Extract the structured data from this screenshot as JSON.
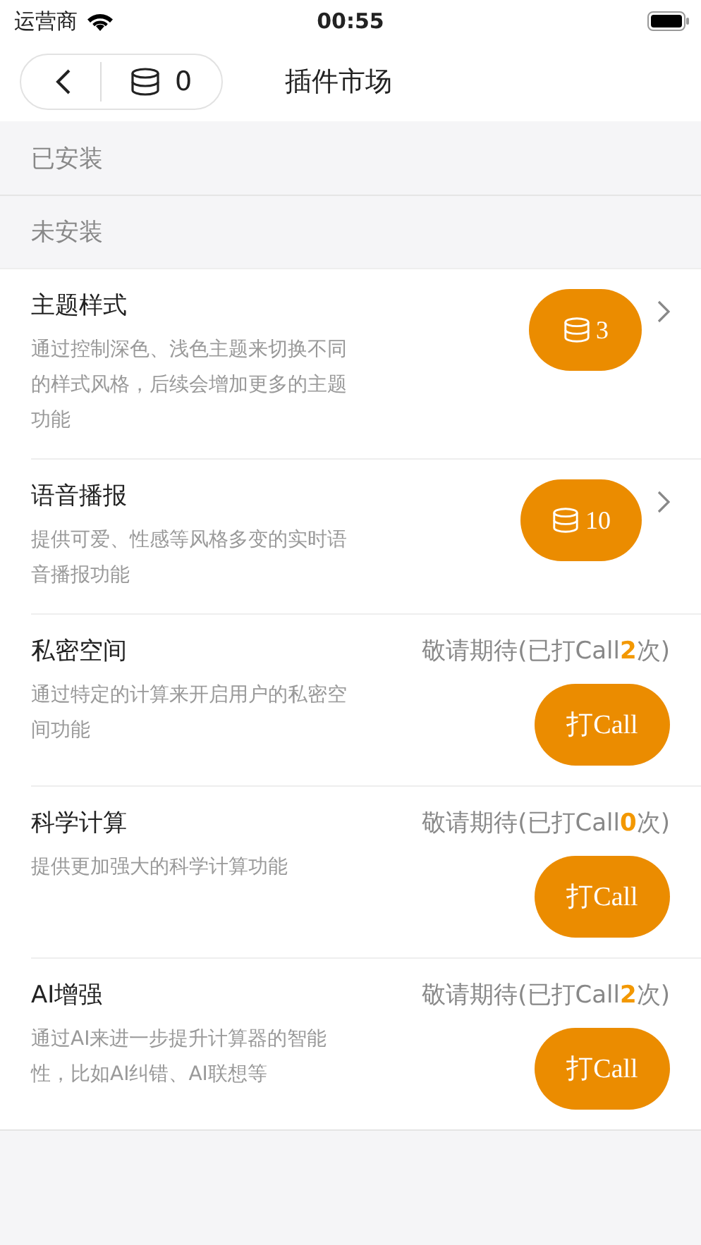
{
  "status_bar": {
    "carrier": "运营商",
    "time": "00:55"
  },
  "header": {
    "coin_count": "0",
    "title": "插件市场"
  },
  "sections": [
    {
      "title": "已安装"
    },
    {
      "title": "未安装"
    }
  ],
  "plugins": [
    {
      "kind": "price",
      "name": "主题样式",
      "description": "通过控制深色、浅色主题来切换不同的样式风格，后续会增加更多的主题功能",
      "price": "3"
    },
    {
      "kind": "price",
      "name": "语音播报",
      "description": "提供可爱、性感等风格多变的实时语音播报功能",
      "price": "10"
    },
    {
      "kind": "call",
      "name": "私密空间",
      "description": "通过特定的计算来开启用户的私密空间功能",
      "status_prefix": "敬请期待(已打Call",
      "call_count": "2",
      "status_suffix": "次)",
      "button": "打Call"
    },
    {
      "kind": "call",
      "name": "科学计算",
      "description": "提供更加强大的科学计算功能",
      "status_prefix": "敬请期待(已打Call",
      "call_count": "0",
      "status_suffix": "次)",
      "button": "打Call"
    },
    {
      "kind": "call",
      "name": "AI增强",
      "description": "通过AI来进一步提升计算器的智能性，比如AI纠错、AI联想等",
      "status_prefix": "敬请期待(已打Call",
      "call_count": "2",
      "status_suffix": "次)",
      "button": "打Call"
    }
  ]
}
